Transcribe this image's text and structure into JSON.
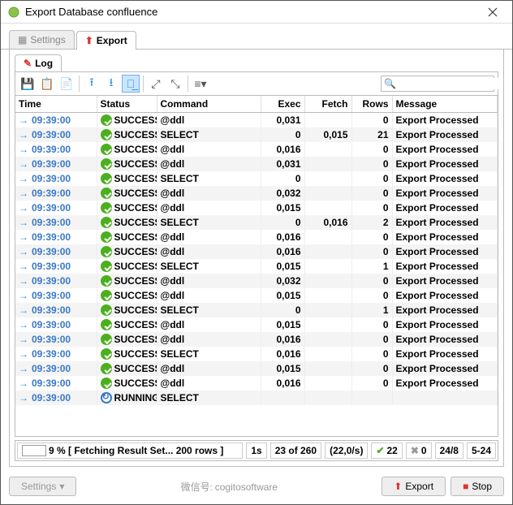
{
  "window": {
    "title": "Export Database confluence"
  },
  "tabs": {
    "settings": "Settings",
    "export": "Export"
  },
  "subtab": {
    "log": "Log"
  },
  "search": {
    "placeholder": ""
  },
  "columns": {
    "time": "Time",
    "status": "Status",
    "command": "Command",
    "exec": "Exec",
    "fetch": "Fetch",
    "rows": "Rows",
    "message": "Message"
  },
  "rows": [
    {
      "time": "09:39:00",
      "status": "SUCCESS",
      "running": false,
      "command": "@ddl",
      "exec": "0,031",
      "fetch": "",
      "rows": "0",
      "message": "Export Processed"
    },
    {
      "time": "09:39:00",
      "status": "SUCCESS",
      "running": false,
      "command": "SELECT",
      "exec": "0",
      "fetch": "0,015",
      "rows": "21",
      "message": "Export Processed"
    },
    {
      "time": "09:39:00",
      "status": "SUCCESS",
      "running": false,
      "command": "@ddl",
      "exec": "0,016",
      "fetch": "",
      "rows": "0",
      "message": "Export Processed"
    },
    {
      "time": "09:39:00",
      "status": "SUCCESS",
      "running": false,
      "command": "@ddl",
      "exec": "0,031",
      "fetch": "",
      "rows": "0",
      "message": "Export Processed"
    },
    {
      "time": "09:39:00",
      "status": "SUCCESS",
      "running": false,
      "command": "SELECT",
      "exec": "0",
      "fetch": "",
      "rows": "0",
      "message": "Export Processed"
    },
    {
      "time": "09:39:00",
      "status": "SUCCESS",
      "running": false,
      "command": "@ddl",
      "exec": "0,032",
      "fetch": "",
      "rows": "0",
      "message": "Export Processed"
    },
    {
      "time": "09:39:00",
      "status": "SUCCESS",
      "running": false,
      "command": "@ddl",
      "exec": "0,015",
      "fetch": "",
      "rows": "0",
      "message": "Export Processed"
    },
    {
      "time": "09:39:00",
      "status": "SUCCESS",
      "running": false,
      "command": "SELECT",
      "exec": "0",
      "fetch": "0,016",
      "rows": "2",
      "message": "Export Processed"
    },
    {
      "time": "09:39:00",
      "status": "SUCCESS",
      "running": false,
      "command": "@ddl",
      "exec": "0,016",
      "fetch": "",
      "rows": "0",
      "message": "Export Processed"
    },
    {
      "time": "09:39:00",
      "status": "SUCCESS",
      "running": false,
      "command": "@ddl",
      "exec": "0,016",
      "fetch": "",
      "rows": "0",
      "message": "Export Processed"
    },
    {
      "time": "09:39:00",
      "status": "SUCCESS",
      "running": false,
      "command": "SELECT",
      "exec": "0,015",
      "fetch": "",
      "rows": "1",
      "message": "Export Processed"
    },
    {
      "time": "09:39:00",
      "status": "SUCCESS",
      "running": false,
      "command": "@ddl",
      "exec": "0,032",
      "fetch": "",
      "rows": "0",
      "message": "Export Processed"
    },
    {
      "time": "09:39:00",
      "status": "SUCCESS",
      "running": false,
      "command": "@ddl",
      "exec": "0,015",
      "fetch": "",
      "rows": "0",
      "message": "Export Processed"
    },
    {
      "time": "09:39:00",
      "status": "SUCCESS",
      "running": false,
      "command": "SELECT",
      "exec": "0",
      "fetch": "",
      "rows": "1",
      "message": "Export Processed"
    },
    {
      "time": "09:39:00",
      "status": "SUCCESS",
      "running": false,
      "command": "@ddl",
      "exec": "0,015",
      "fetch": "",
      "rows": "0",
      "message": "Export Processed"
    },
    {
      "time": "09:39:00",
      "status": "SUCCESS",
      "running": false,
      "command": "@ddl",
      "exec": "0,016",
      "fetch": "",
      "rows": "0",
      "message": "Export Processed"
    },
    {
      "time": "09:39:00",
      "status": "SUCCESS",
      "running": false,
      "command": "SELECT",
      "exec": "0,016",
      "fetch": "",
      "rows": "0",
      "message": "Export Processed"
    },
    {
      "time": "09:39:00",
      "status": "SUCCESS",
      "running": false,
      "command": "@ddl",
      "exec": "0,015",
      "fetch": "",
      "rows": "0",
      "message": "Export Processed"
    },
    {
      "time": "09:39:00",
      "status": "SUCCESS",
      "running": false,
      "command": "@ddl",
      "exec": "0,016",
      "fetch": "",
      "rows": "0",
      "message": "Export Processed"
    },
    {
      "time": "09:39:00",
      "status": "RUNNING",
      "running": true,
      "command": "SELECT",
      "exec": "",
      "fetch": "",
      "rows": "",
      "message": ""
    }
  ],
  "status": {
    "progress_pct": 9,
    "progress_text": "9 % [ Fetching Result Set... 200 rows ]",
    "elapsed": "1s",
    "count": "23 of 260",
    "rate": "(22,0/s)",
    "ok": "22",
    "fail": "0",
    "box1": "24/8",
    "box2": "5-24"
  },
  "footer": {
    "settings": "Settings",
    "export": "Export",
    "stop": "Stop"
  },
  "watermark": {
    "label": "微信号",
    "value": "cogitosoftware"
  }
}
